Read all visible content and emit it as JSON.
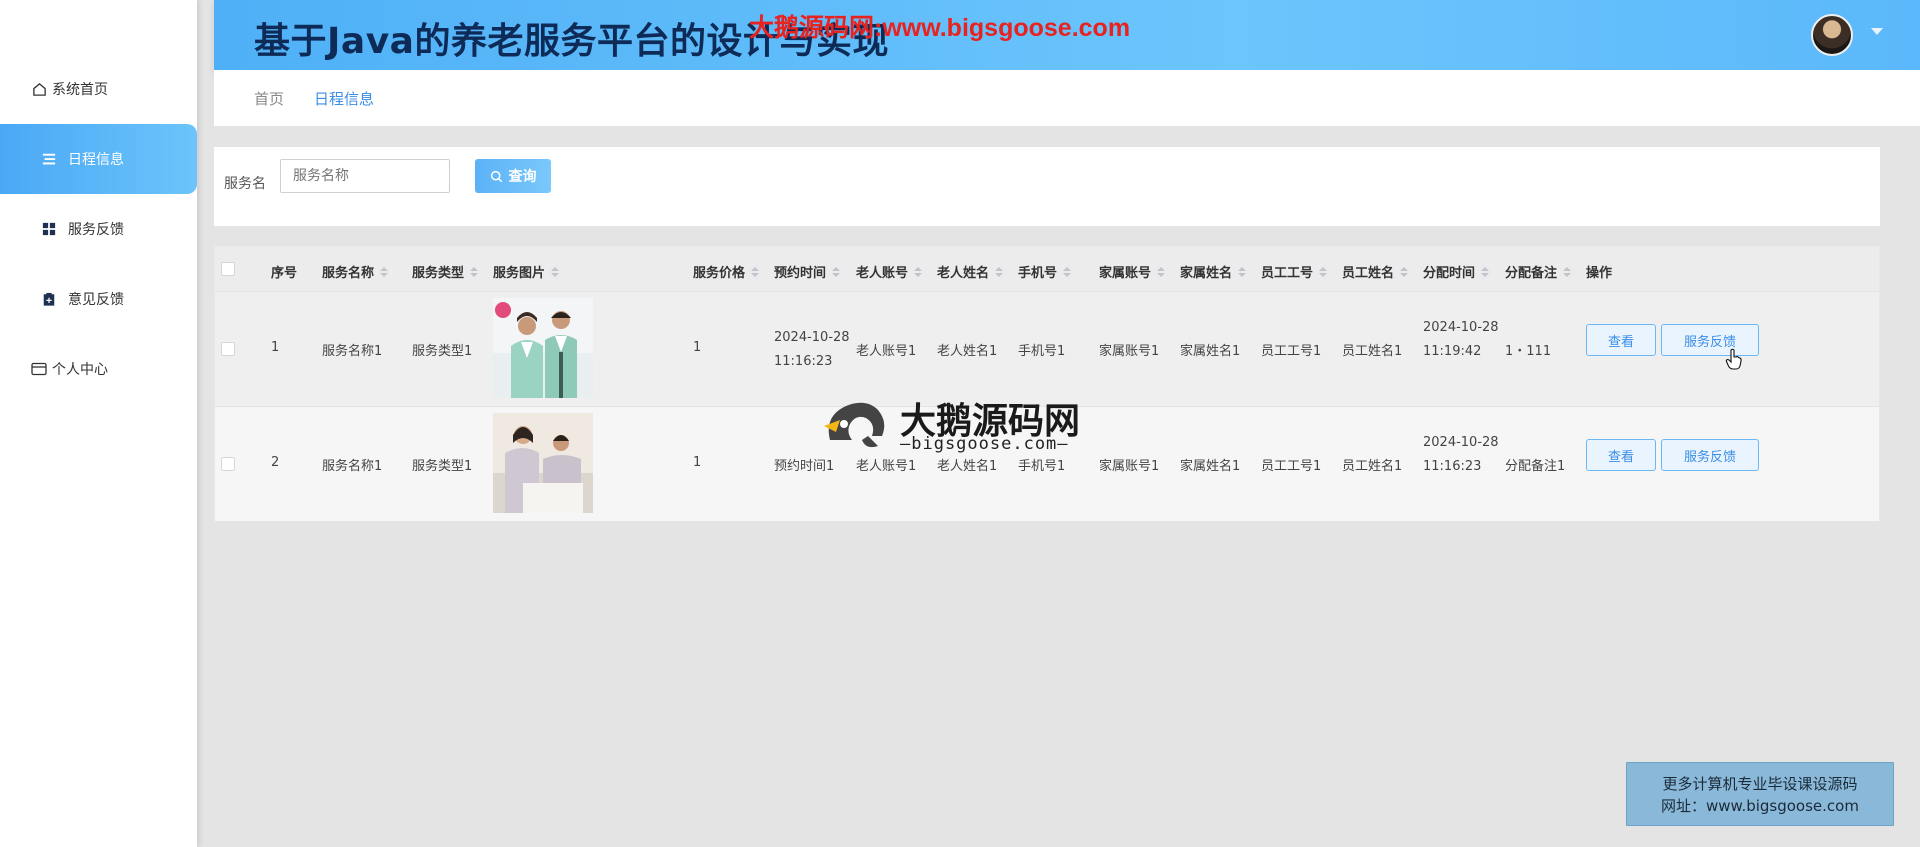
{
  "app": {
    "title": "基于Java的养老服务平台的设计与实现",
    "watermark_top": "大鹅源码网:www.bigsgoose.com"
  },
  "sidebar": {
    "items": [
      {
        "label": "系统首页",
        "icon": "home-icon"
      },
      {
        "label": "日程信息",
        "icon": "list-icon",
        "active": true
      },
      {
        "label": "服务反馈",
        "icon": "grid-icon"
      },
      {
        "label": "意见反馈",
        "icon": "clipboard-icon"
      },
      {
        "label": "个人中心",
        "icon": "card-icon"
      }
    ]
  },
  "breadcrumb": {
    "items": [
      "首页",
      "日程信息"
    ]
  },
  "search": {
    "label": "服务名",
    "placeholder": "服务名称",
    "button": "查询"
  },
  "table": {
    "columns": [
      "序号",
      "服务名称",
      "服务类型",
      "服务图片",
      "服务价格",
      "预约时间",
      "老人账号",
      "老人姓名",
      "手机号",
      "家属账号",
      "家属姓名",
      "员工工号",
      "员工姓名",
      "分配时间",
      "分配备注",
      "操作"
    ],
    "rows": [
      {
        "index": "1",
        "service_name": "服务名称1",
        "service_type": "服务类型1",
        "price": "1",
        "booking_time": [
          "2024-10-28",
          "11:16:23"
        ],
        "elder_account": "老人账号1",
        "elder_name": "老人姓名1",
        "phone": "手机号1",
        "family_account": "家属账号1",
        "family_name": "家属姓名1",
        "staff_id": "员工工号1",
        "staff_name": "员工姓名1",
        "assign_time": [
          "2024-10-28",
          "11:19:42"
        ],
        "assign_note": "1・111"
      },
      {
        "index": "2",
        "service_name": "服务名称1",
        "service_type": "服务类型1",
        "price": "1",
        "booking_time": [
          "预约时间1",
          ""
        ],
        "elder_account": "老人账号1",
        "elder_name": "老人姓名1",
        "phone": "手机号1",
        "family_account": "家属账号1",
        "family_name": "家属姓名1",
        "staff_id": "员工工号1",
        "staff_name": "员工姓名1",
        "assign_time": [
          "2024-10-28",
          "11:16:23"
        ],
        "assign_note": "分配备注1"
      }
    ],
    "actions": {
      "view": "查看",
      "feedback": "服务反馈"
    }
  },
  "watermark_center": {
    "name": "大鹅源码网",
    "url": "—bigsgoose.com—"
  },
  "promo": {
    "line1": "更多计算机专业毕设课设源码",
    "line2": "网址：www.bigsgoose.com"
  },
  "colors": {
    "accent": "#4aa8f5",
    "title": "#0e2b58",
    "watermark": "#e8221e"
  }
}
